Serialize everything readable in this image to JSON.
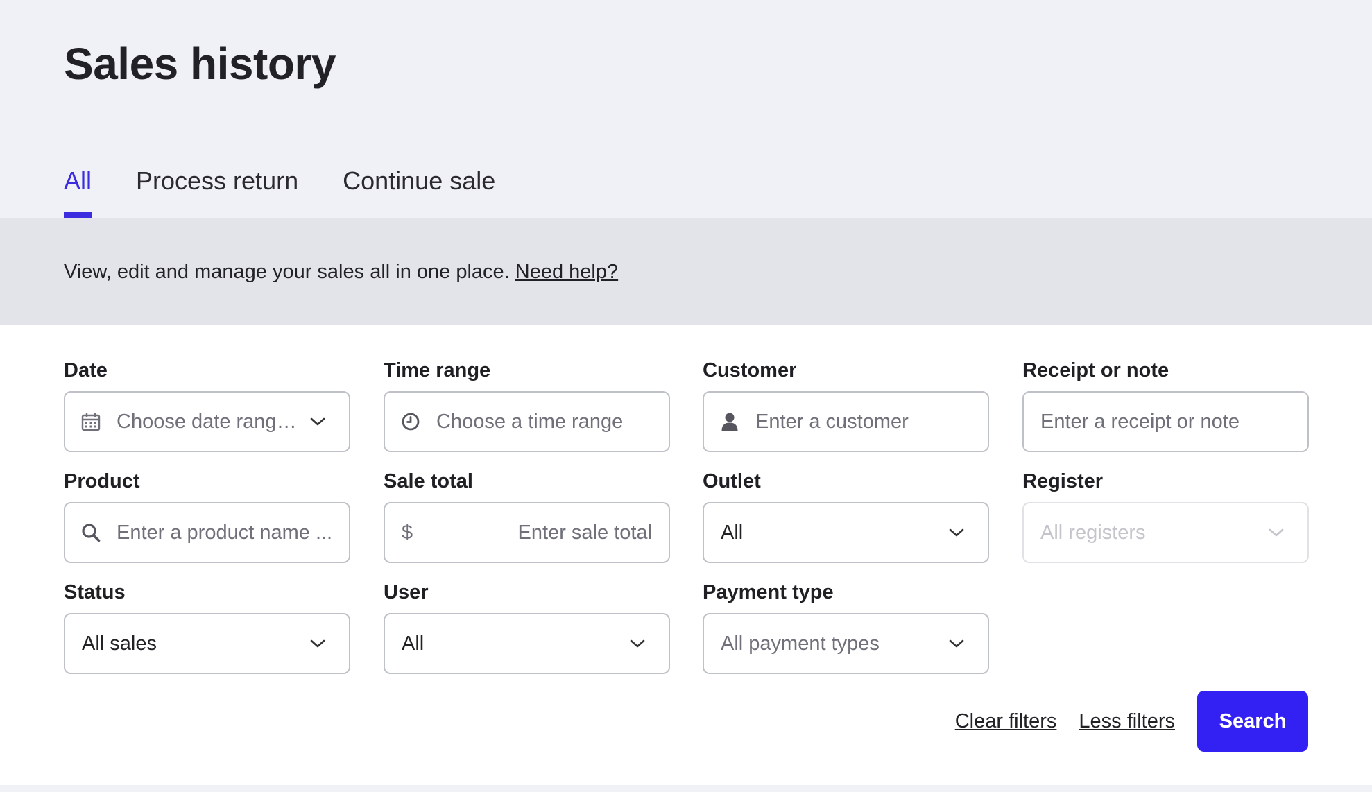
{
  "header": {
    "title": "Sales history",
    "tabs": [
      {
        "label": "All",
        "active": true
      },
      {
        "label": "Process return",
        "active": false
      },
      {
        "label": "Continue sale",
        "active": false
      }
    ]
  },
  "info": {
    "text": "View, edit and manage your sales all in one place.",
    "help_link": "Need help?"
  },
  "filters": {
    "date": {
      "label": "Date",
      "placeholder": "Choose date range...",
      "icon": "calendar-icon"
    },
    "time_range": {
      "label": "Time range",
      "placeholder": "Choose a time range",
      "icon": "clock-icon"
    },
    "customer": {
      "label": "Customer",
      "placeholder": "Enter a customer",
      "icon": "user-icon"
    },
    "receipt": {
      "label": "Receipt or note",
      "placeholder": "Enter a receipt or note"
    },
    "product": {
      "label": "Product",
      "placeholder": "Enter a product name ...",
      "icon": "search-icon"
    },
    "sale_total": {
      "label": "Sale total",
      "prefix": "$",
      "placeholder": "Enter sale total"
    },
    "outlet": {
      "label": "Outlet",
      "value": "All"
    },
    "register": {
      "label": "Register",
      "placeholder": "All registers",
      "disabled": true
    },
    "status": {
      "label": "Status",
      "value": "All sales"
    },
    "user": {
      "label": "User",
      "value": "All"
    },
    "payment_type": {
      "label": "Payment type",
      "placeholder": "All payment types"
    }
  },
  "actions": {
    "clear": "Clear filters",
    "less": "Less filters",
    "search": "Search"
  },
  "colors": {
    "accent": "#3b2ce0",
    "button": "#3320f2",
    "header_bg": "#f0f1f6",
    "info_bg": "#e3e4e9"
  }
}
